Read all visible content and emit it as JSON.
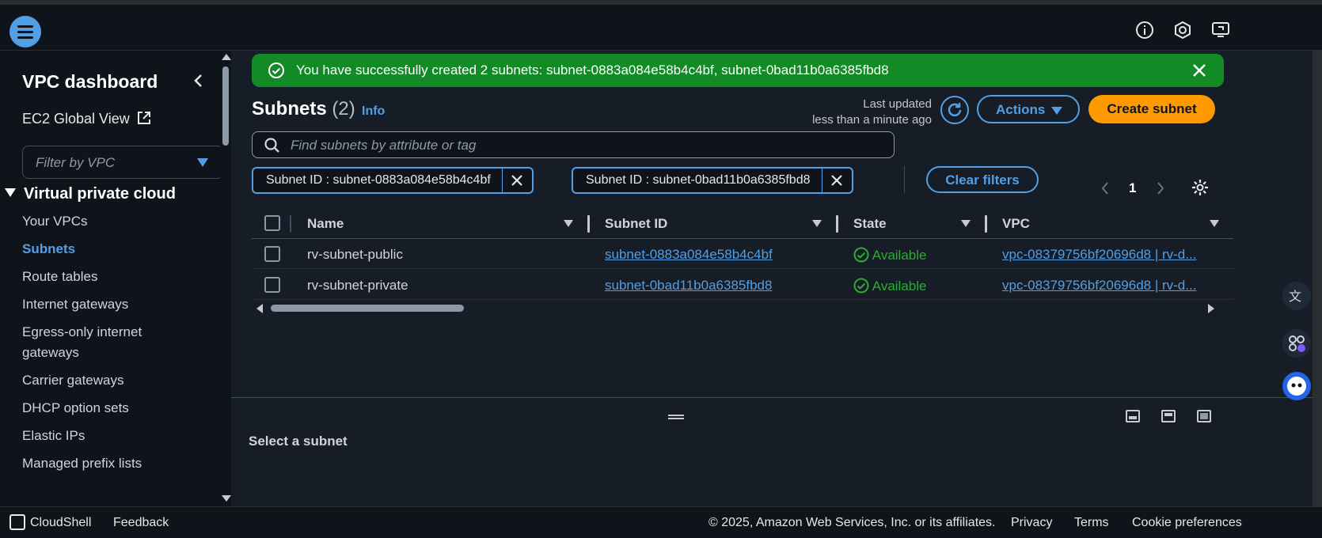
{
  "topbar": {
    "icons": [
      "menu-icon",
      "info-icon",
      "support-icon",
      "remote-screen-icon"
    ]
  },
  "sidebar": {
    "title": "VPC dashboard",
    "global_view": "EC2 Global View",
    "filter_placeholder": "Filter by VPC",
    "section": "Virtual private cloud",
    "items": [
      {
        "label": "Your VPCs"
      },
      {
        "label": "Subnets",
        "active": true
      },
      {
        "label": "Route tables"
      },
      {
        "label": "Internet gateways"
      },
      {
        "label": "Egress-only internet gateways"
      },
      {
        "label": "Carrier gateways"
      },
      {
        "label": "DHCP option sets"
      },
      {
        "label": "Elastic IPs"
      },
      {
        "label": "Managed prefix lists"
      }
    ]
  },
  "flash": {
    "message": "You have successfully created 2 subnets: subnet-0883a084e58b4c4bf, subnet-0bad11b0a6385fbd8",
    "color": "#128a26"
  },
  "header": {
    "title": "Subnets",
    "count": "(2)",
    "info": "Info",
    "last_updated_label": "Last updated",
    "last_updated_value": "less than a minute ago",
    "actions_label": "Actions",
    "create_label": "Create subnet"
  },
  "search": {
    "placeholder": "Find subnets by attribute or tag"
  },
  "filters": {
    "tokens": [
      "Subnet ID : subnet-0883a084e58b4c4bf",
      "Subnet ID : subnet-0bad11b0a6385fbd8"
    ],
    "clear_label": "Clear filters"
  },
  "pagination": {
    "page": "1"
  },
  "table": {
    "columns": [
      "Name",
      "Subnet ID",
      "State",
      "VPC"
    ],
    "rows": [
      {
        "name": "rv-subnet-public",
        "subnet_id": "subnet-0883a084e58b4c4bf",
        "state": "Available",
        "vpc": "vpc-08379756bf20696d8 | rv-d..."
      },
      {
        "name": "rv-subnet-private",
        "subnet_id": "subnet-0bad11b0a6385fbd8",
        "state": "Available",
        "vpc": "vpc-08379756bf20696d8 | rv-d..."
      }
    ]
  },
  "detail": {
    "placeholder": "Select a subnet"
  },
  "footer": {
    "cloudshell": "CloudShell",
    "feedback": "Feedback",
    "copyright": "© 2025, Amazon Web Services, Inc. or its affiliates.",
    "privacy": "Privacy",
    "terms": "Terms",
    "cookies": "Cookie preferences"
  },
  "colors": {
    "accent": "#539fe5",
    "primary_button": "#ff9900",
    "success": "#29ad32"
  }
}
